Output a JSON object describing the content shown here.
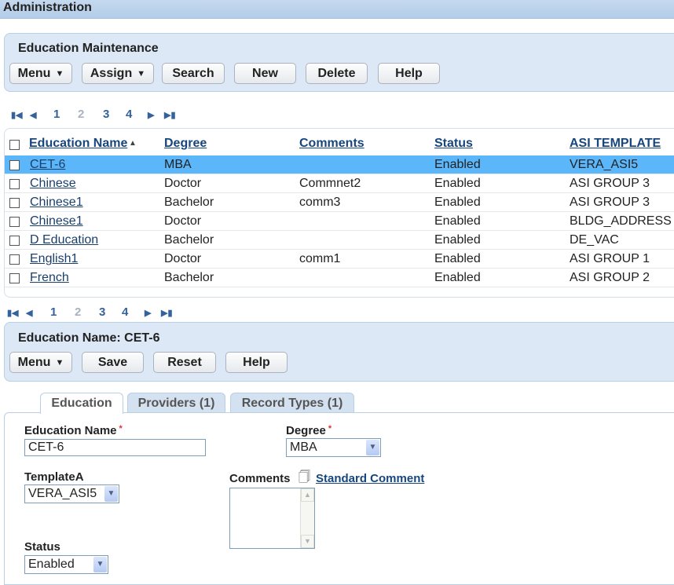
{
  "header": {
    "title": "Administration"
  },
  "maintenance": {
    "title": "Education Maintenance",
    "buttons": {
      "menu": "Menu",
      "assign": "Assign",
      "search": "Search",
      "new": "New",
      "delete": "Delete",
      "help": "Help"
    }
  },
  "pager": {
    "pages": [
      "1",
      "2",
      "3",
      "4"
    ],
    "current": "2"
  },
  "table": {
    "columns": [
      "Education Name",
      "Degree",
      "Comments",
      "Status",
      "ASI TEMPLATE"
    ],
    "sort": {
      "column": "Education Name",
      "direction": "ascending"
    },
    "rows": [
      {
        "name": "CET-6",
        "degree": "MBA",
        "comments": "",
        "status": "Enabled",
        "asi": "VERA_ASI5",
        "selected": true
      },
      {
        "name": "Chinese",
        "degree": "Doctor",
        "comments": "Commnet2",
        "status": "Enabled",
        "asi": "ASI GROUP 3"
      },
      {
        "name": "Chinese1",
        "degree": "Bachelor",
        "comments": "comm3",
        "status": "Enabled",
        "asi": "ASI GROUP 3"
      },
      {
        "name": "Chinese1",
        "degree": "Doctor",
        "comments": "",
        "status": "Enabled",
        "asi": "BLDG_ADDRESS"
      },
      {
        "name": "D Education",
        "degree": "Bachelor",
        "comments": "",
        "status": "Enabled",
        "asi": "DE_VAC"
      },
      {
        "name": "English1",
        "degree": "Doctor",
        "comments": "comm1",
        "status": "Enabled",
        "asi": "ASI GROUP 1"
      },
      {
        "name": "French",
        "degree": "Bachelor",
        "comments": "",
        "status": "Enabled",
        "asi": "ASI GROUP 2"
      }
    ]
  },
  "detail": {
    "title": "Education Name: CET-6",
    "buttons": {
      "menu": "Menu",
      "save": "Save",
      "reset": "Reset",
      "help": "Help"
    }
  },
  "tabs": [
    "Education",
    "Providers (1)",
    "Record Types (1)"
  ],
  "form": {
    "education_name_label": "Education Name",
    "education_name": "CET-6",
    "degree_label": "Degree",
    "degree": "MBA",
    "template_label": "TemplateA",
    "template": "VERA_ASI5",
    "comments_label": "Comments",
    "standard_comment": "Standard Comment",
    "comments": "",
    "status_label": "Status",
    "status": "Enabled",
    "required_mark": "*"
  },
  "colors": {
    "selected_row": "#5cb6fa",
    "link": "#17467f",
    "panel": "#dce8f5"
  }
}
